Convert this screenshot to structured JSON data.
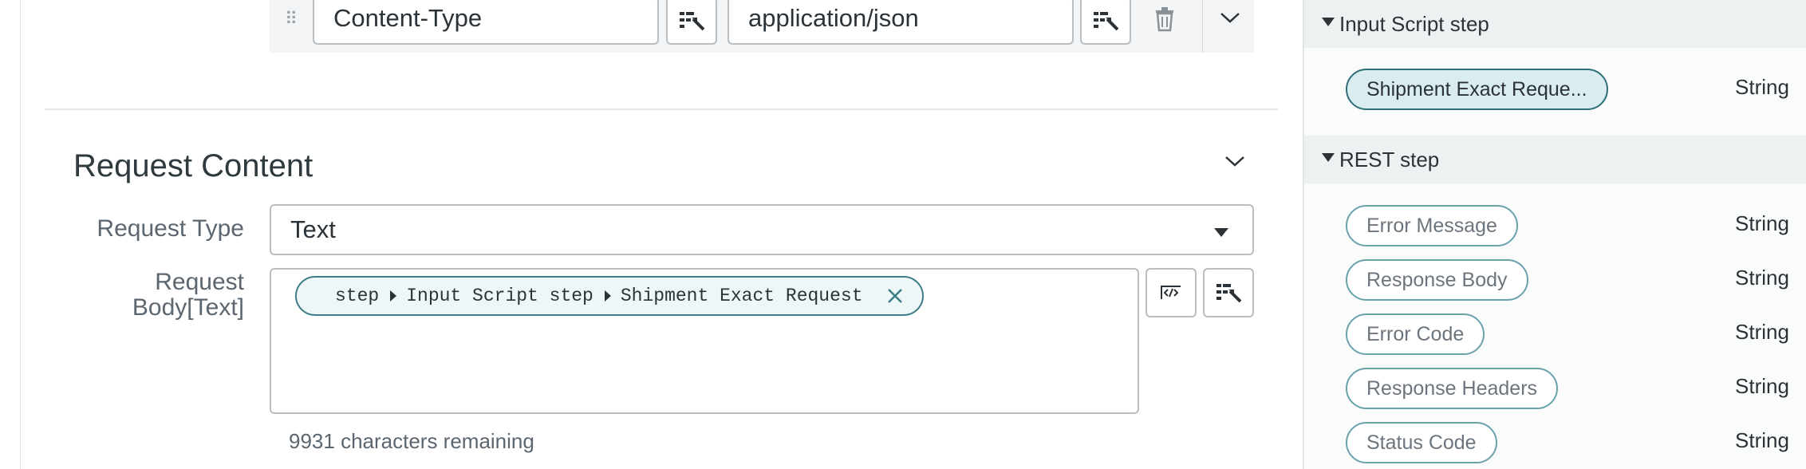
{
  "header_row": {
    "key_value": "Content-Type",
    "value_value": "application/json"
  },
  "request_content": {
    "title": "Request Content",
    "request_type_label": "Request Type",
    "request_type_value": "Text",
    "request_body_label_line1": "Request",
    "request_body_label_line2": "Body[Text]",
    "token": {
      "part1": "step",
      "part2": "Input Script step",
      "part3": "Shipment Exact Request"
    },
    "chars_remaining": "9931 characters remaining"
  },
  "right_panel": {
    "groups": [
      {
        "title": "Input Script step",
        "items": [
          {
            "label": "Shipment Exact Reque...",
            "type": "String"
          }
        ]
      },
      {
        "title": "REST step",
        "items": [
          {
            "label": "Error Message",
            "type": "String"
          },
          {
            "label": "Response Body",
            "type": "String"
          },
          {
            "label": "Error Code",
            "type": "String"
          },
          {
            "label": "Response Headers",
            "type": "String"
          },
          {
            "label": "Status Code",
            "type": "String"
          }
        ]
      }
    ]
  },
  "colors": {
    "accent": "#3d7d87",
    "selected_pill": "#d9ecef"
  },
  "icons": [
    "drag-handle-icon",
    "variable-picker-icon",
    "trash-icon",
    "chevron-down-icon",
    "code-icon",
    "close-icon",
    "triangle-down-icon",
    "triangle-right-icon"
  ]
}
